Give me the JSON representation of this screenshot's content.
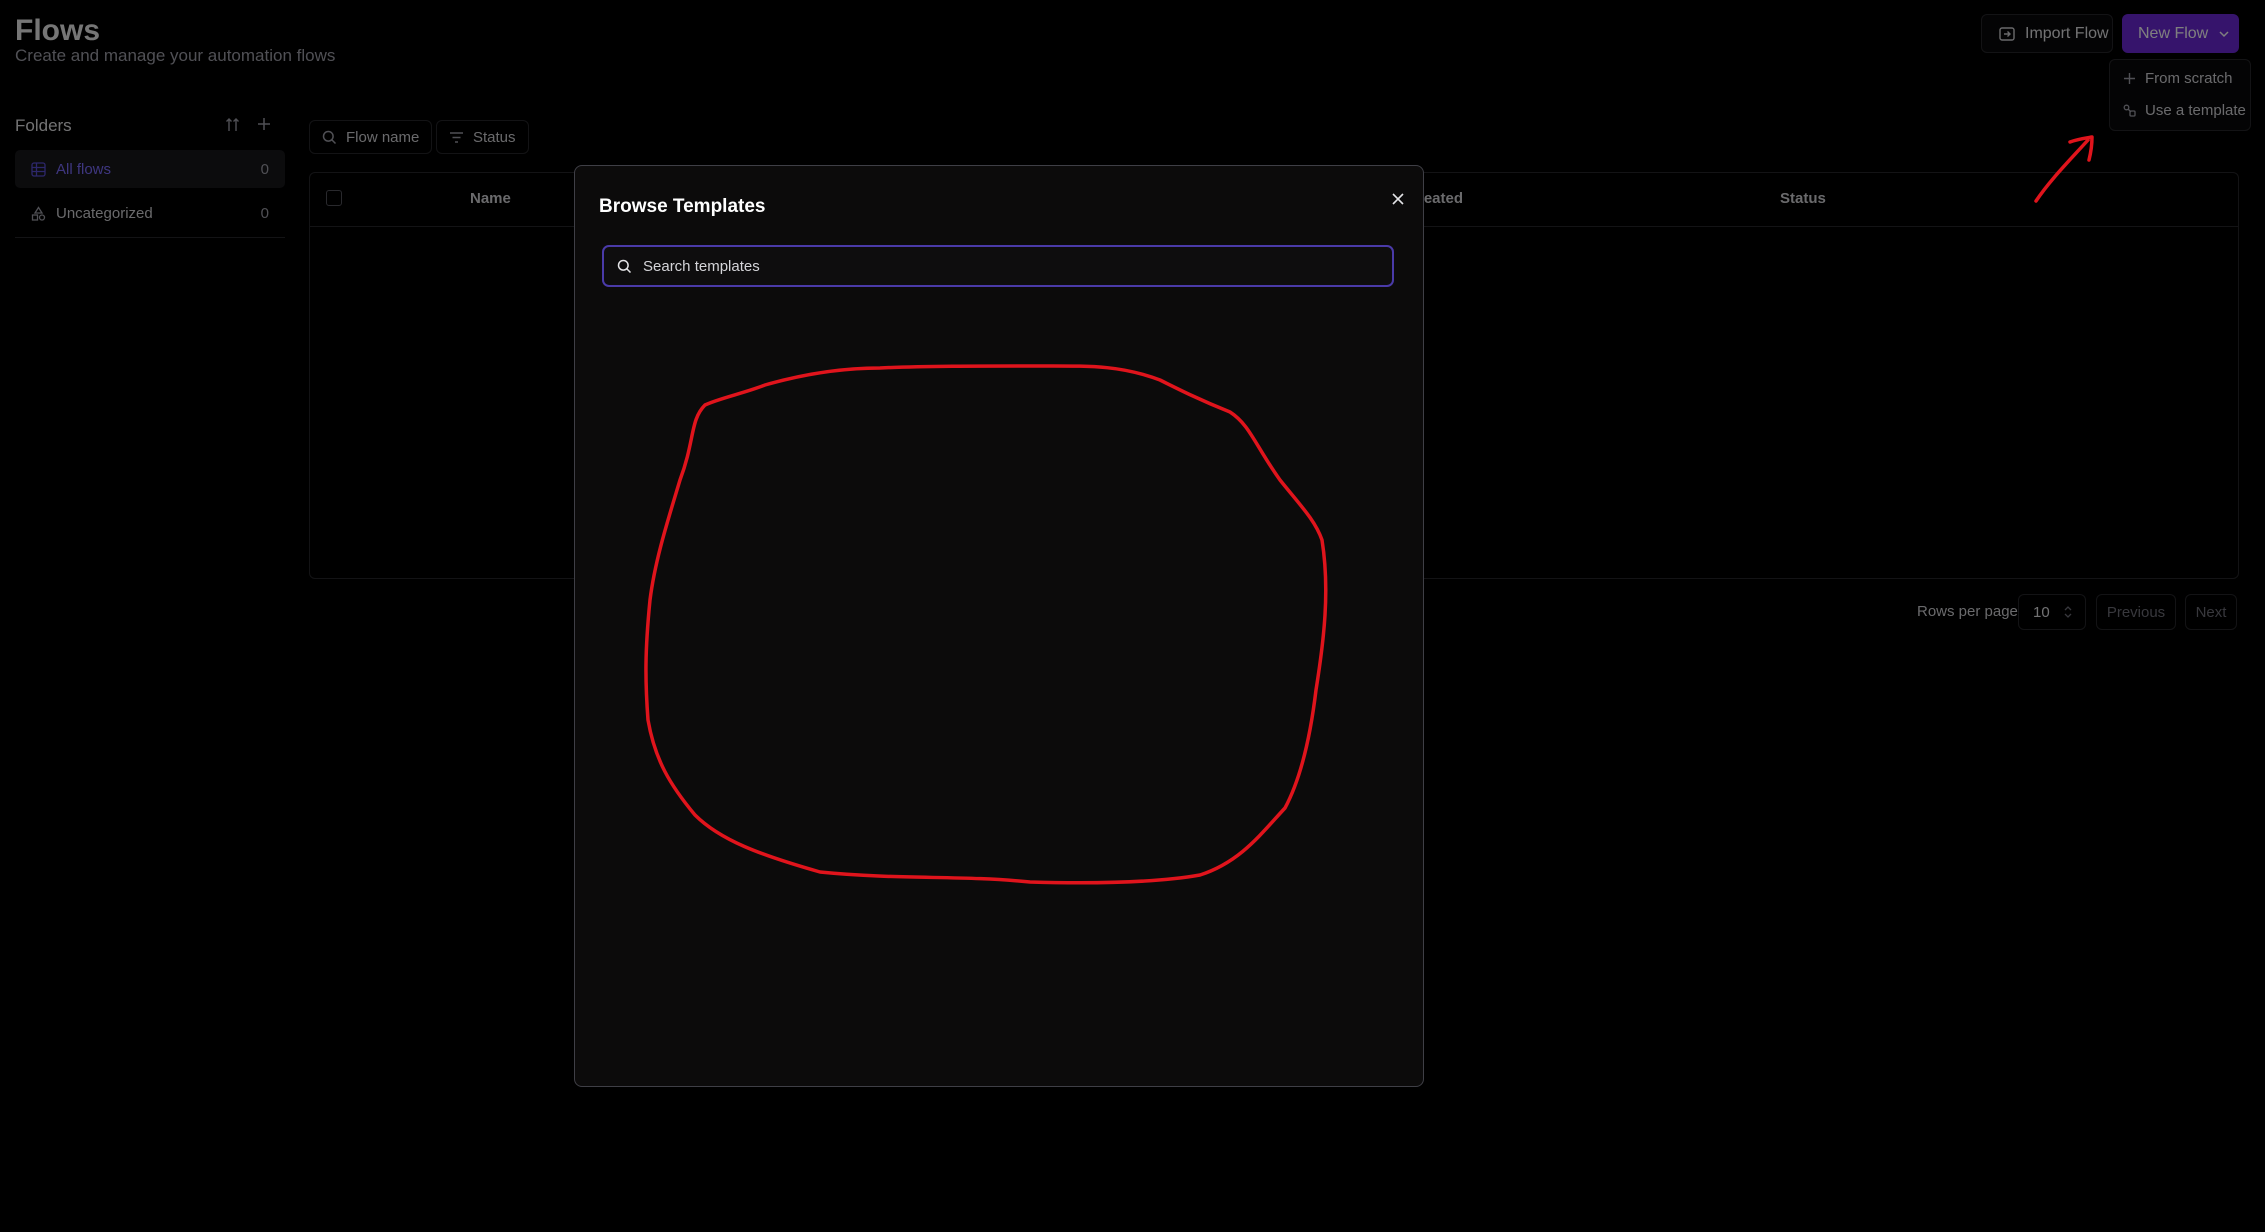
{
  "header": {
    "title": "Flows",
    "subtitle": "Create and manage your automation flows",
    "import_label": "Import Flow",
    "new_flow_label": "New Flow"
  },
  "new_flow_menu": {
    "items": [
      {
        "label": "From scratch",
        "icon": "plus-icon"
      },
      {
        "label": "Use a template",
        "icon": "template-icon"
      }
    ]
  },
  "folders": {
    "title": "Folders",
    "items": [
      {
        "label": "All flows",
        "count": "0",
        "icon": "table-icon",
        "active": true
      },
      {
        "label": "Uncategorized",
        "count": "0",
        "icon": "shapes-icon",
        "active": false
      }
    ]
  },
  "filters": {
    "flow_name": "Flow name",
    "status": "Status"
  },
  "table": {
    "columns": [
      "Name",
      "reated",
      "Status"
    ]
  },
  "pagination": {
    "rows_per_page_label": "Rows per page",
    "rows_per_page_value": "10",
    "previous": "Previous",
    "next": "Next"
  },
  "modal": {
    "title": "Browse Templates",
    "search_placeholder": "Search templates"
  },
  "colors": {
    "accent": "#6d28d9",
    "annotation": "#e0141c",
    "focus_ring": "#4a3aa8"
  }
}
